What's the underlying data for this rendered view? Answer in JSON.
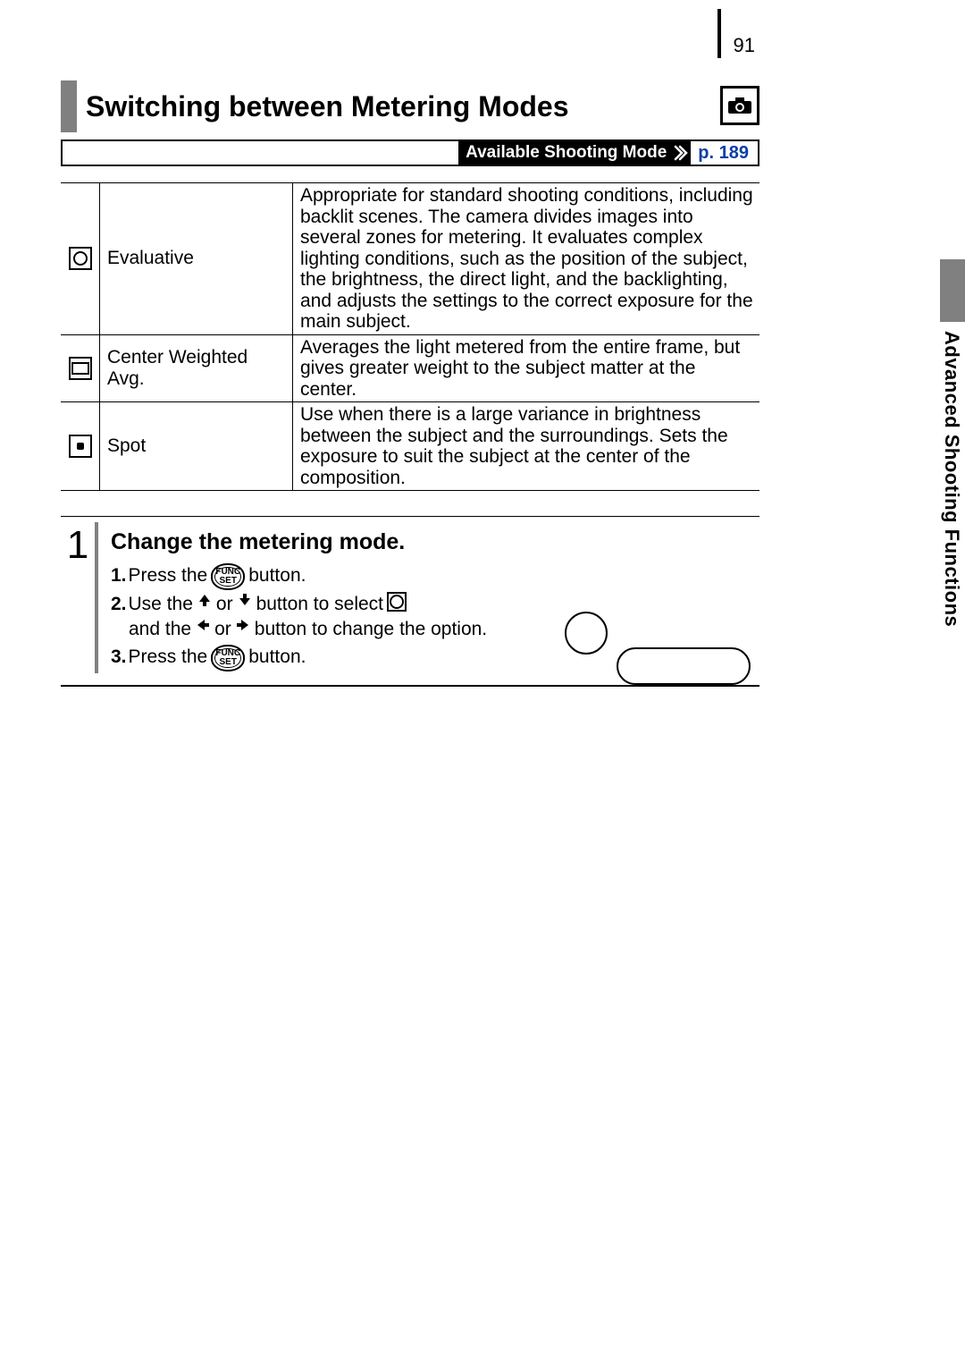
{
  "page_number": "91",
  "section_tab": "Advanced Shooting Functions",
  "heading": "Switching between Metering Modes",
  "heading_icon": "camera-icon",
  "availability": {
    "label": "Available Shooting Mode",
    "ref": "p. 189"
  },
  "metering_modes": [
    {
      "icon": "evaluative-metering-icon",
      "name": "Evaluative",
      "description": "Appropriate for standard shooting conditions, including backlit scenes. The camera divides images into several zones for metering. It evaluates complex lighting conditions, such as the position of the subject, the brightness, the direct light, and the backlighting, and adjusts the settings to the correct exposure for the main subject."
    },
    {
      "icon": "center-weighted-metering-icon",
      "name": "Center Weighted Avg.",
      "description": "Averages the light metered from the entire frame, but gives greater weight to the subject matter at the center."
    },
    {
      "icon": "spot-metering-icon",
      "name": "Spot",
      "description": "Use when there is a large variance in brightness between the subject and the surroundings. Sets the exposure to suit the subject at the center of the composition."
    }
  ],
  "step": {
    "number": "1",
    "title": "Change the metering mode.",
    "substeps": {
      "s1": {
        "n": "1.",
        "a": "Press the",
        "b": "button."
      },
      "s2": {
        "n": "2.",
        "a": "Use the",
        "b": "or",
        "c": "button to select",
        "d": "and the",
        "e": "or",
        "f": "button to change the option."
      },
      "s3": {
        "n": "3.",
        "a": "Press the",
        "b": "button."
      }
    },
    "func_label_top": "FUNC",
    "func_label_bottom": "SET"
  }
}
